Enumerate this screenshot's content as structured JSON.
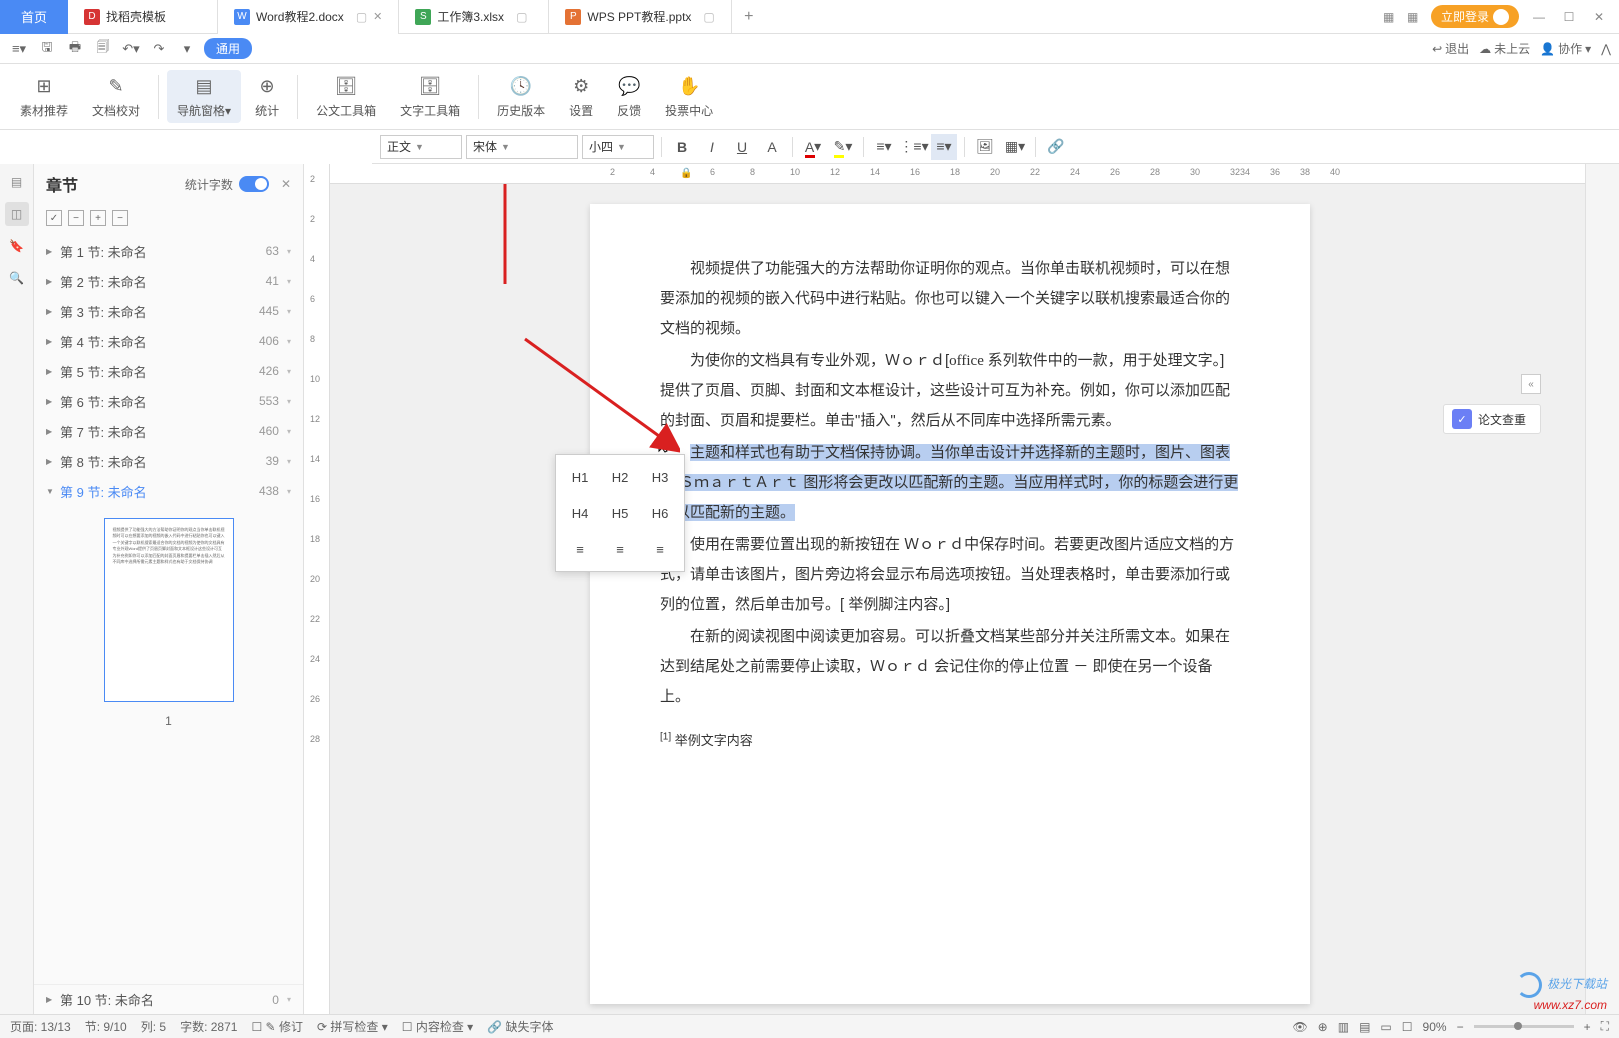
{
  "titlebar": {
    "home": "首页",
    "tabs": [
      {
        "icon": "d",
        "label": "找稻壳模板"
      },
      {
        "icon": "w",
        "label": "Word教程2.docx",
        "active": true
      },
      {
        "icon": "s",
        "label": "工作簿3.xlsx"
      },
      {
        "icon": "p",
        "label": "WPS PPT教程.pptx"
      }
    ],
    "login": "立即登录",
    "win_min": "—",
    "win_max": "☐",
    "win_close": "✕"
  },
  "quickbar": {
    "pill": "通用",
    "exit": "退出",
    "cloud": "未上云",
    "coop": "协作",
    "dd": "▾"
  },
  "ribbon": [
    {
      "icon": "☰",
      "label": "素材推荐"
    },
    {
      "icon": "✎",
      "label": "文档校对"
    },
    {
      "icon": "▤",
      "label": "导航窗格",
      "dd": "▾",
      "active": true
    },
    {
      "icon": "Σ",
      "label": "统计"
    },
    {
      "icon": "🖿",
      "label": "公文工具箱"
    },
    {
      "icon": "文",
      "label": "文字工具箱"
    },
    {
      "icon": "🕓",
      "label": "历史版本"
    },
    {
      "icon": "⚙",
      "label": "设置"
    },
    {
      "icon": "💬",
      "label": "反馈"
    },
    {
      "icon": "✋",
      "label": "投票中心"
    }
  ],
  "fmt": {
    "style": "正文",
    "font": "宋体",
    "size": "小四"
  },
  "nav": {
    "title": "章节",
    "stat_label": "统计字数",
    "items": [
      {
        "label": "第 1 节: 未命名",
        "count": "63"
      },
      {
        "label": "第 2 节: 未命名",
        "count": "41"
      },
      {
        "label": "第 3 节: 未命名",
        "count": "445"
      },
      {
        "label": "第 4 节: 未命名",
        "count": "406"
      },
      {
        "label": "第 5 节: 未命名",
        "count": "426"
      },
      {
        "label": "第 6 节: 未命名",
        "count": "553"
      },
      {
        "label": "第 7 节: 未命名",
        "count": "460"
      },
      {
        "label": "第 8 节: 未命名",
        "count": "39"
      },
      {
        "label": "第 9 节: 未命名",
        "count": "438",
        "sel": true
      }
    ],
    "thumb_num": "1",
    "bottom": {
      "label": "第 10 节: 未命名",
      "count": "0"
    }
  },
  "doc": {
    "p1": "视频提供了功能强大的方法帮助你证明你的观点。当你单击联机视频时，可以在想要添加的视频的嵌入代码中进行粘贴。你也可以键入一个关键字以联机搜索最适合你的文档的视频。",
    "p2a": "为使你的文档具有专业外观，Ｗｏｒｄ[",
    "p2note": "office 系列软件中的一款，用于处理文字。",
    "p2b": "]  提供了页眉、页脚、封面和文本框设计，这些设计可互为补充。例如，你可以添加匹配的封面、页眉和提要栏。单击\"插入\"，然后从不同库中选择所需元素。",
    "p3a": "主题和样式也有助于文档保持协调。当你单击设计并选择新的主题时，图片、图表或 ＳｍａｒｔＡｒｔ 图形将会更改以匹配新的主题。当应用样式时，你的标题会进行更改以匹配新的主题。",
    "p4": "使用在需要位置出现的新按钮在 Ｗｏｒｄ中保存时间。若要更改图片适应文档的方式，请单击该图片，图片旁边将会显示布局选项按钮。当处理表格时，单击要添加行或列的位置，然后单击加号。[ 举例脚注内容。]",
    "p5": "在新的阅读视图中阅读更加容易。可以折叠文档某些部分并关注所需文本。如果在达到结尾处之前需要停止读取，Ｗｏｒｄ  会记住你的停止位置  －  即使在另一个设备上。",
    "fn_mark": "[1]",
    "fn_text": "举例文字内容"
  },
  "popup": {
    "h1": "H1",
    "h2": "H2",
    "h3": "H3",
    "h4": "H4",
    "h5": "H5",
    "h6": "H6",
    "a1": "≡",
    "a2": "≡",
    "a3": "≡"
  },
  "rpanel": {
    "check": "论文查重"
  },
  "ruler_h": [
    "2",
    "4",
    "6",
    "8",
    "10",
    "12",
    "14",
    "16",
    "18",
    "20",
    "22",
    "24",
    "26",
    "28",
    "30",
    "32",
    "34",
    "36",
    "38",
    "40"
  ],
  "ruler_v": [
    "2",
    "2",
    "4",
    "6",
    "8",
    "10",
    "12",
    "14",
    "16",
    "18",
    "20",
    "22",
    "24",
    "26",
    "28"
  ],
  "status": {
    "page": "页面: 13/13",
    "sec": "节: 9/10",
    "col": "列: 5",
    "chars": "字数: 2871",
    "edit": "修订",
    "spell": "拼写检查",
    "content": "内容检查",
    "font_missing": "缺失字体",
    "zoom": "90%"
  },
  "watermark": {
    "site": "极光下载站",
    "url": "www.xz7.com"
  }
}
